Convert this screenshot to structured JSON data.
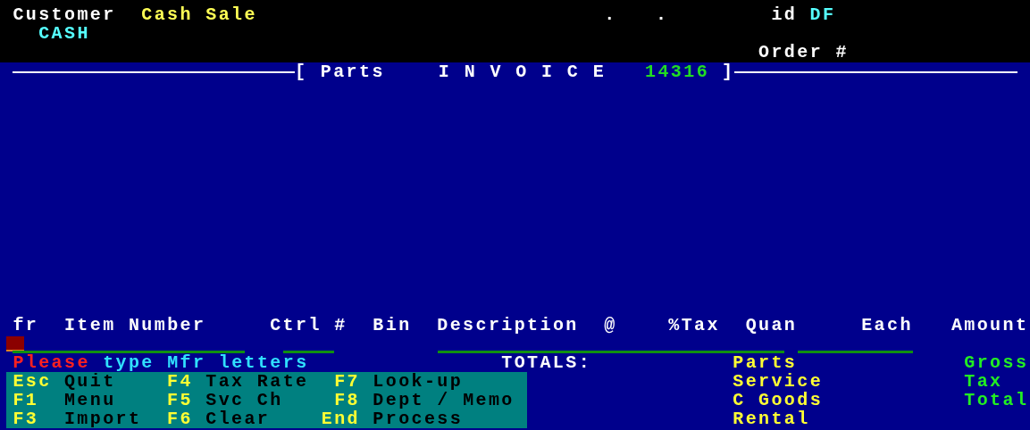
{
  "header": {
    "customer_label": "Customer",
    "customer_name": "Cash Sale",
    "customer_code": "CASH",
    "dots": [
      ".",
      "."
    ],
    "id_label": "id",
    "id_value": "DF",
    "order_label": "Order #"
  },
  "title": {
    "open": "[ Parts",
    "main": "I N V O I C E",
    "number": "14316",
    "close": "]"
  },
  "columns": [
    "fr",
    "Item Number",
    "Ctrl #",
    "Bin",
    "Description",
    "@",
    "%Tax",
    "Quan",
    "Each",
    "Amount"
  ],
  "message": {
    "alert": "Please",
    "text": "type Mfr letters"
  },
  "totals_label": "TOTALS:",
  "totals_left": [
    "Parts",
    "Service",
    "C Goods",
    "Rental"
  ],
  "totals_right": [
    "Gross",
    "Tax",
    "Total"
  ],
  "keys": [
    {
      "key": "Esc",
      "action": "Quit"
    },
    {
      "key": "F4",
      "action": "Tax Rate"
    },
    {
      "key": "F7",
      "action": "Look-up"
    },
    {
      "key": "F1",
      "action": "Menu"
    },
    {
      "key": "F5",
      "action": "Svc Ch"
    },
    {
      "key": "F8",
      "action": "Dept / Memo"
    },
    {
      "key": "F3",
      "action": "Import"
    },
    {
      "key": "F6",
      "action": "Clear"
    },
    {
      "key": "End",
      "action": "Process"
    }
  ]
}
